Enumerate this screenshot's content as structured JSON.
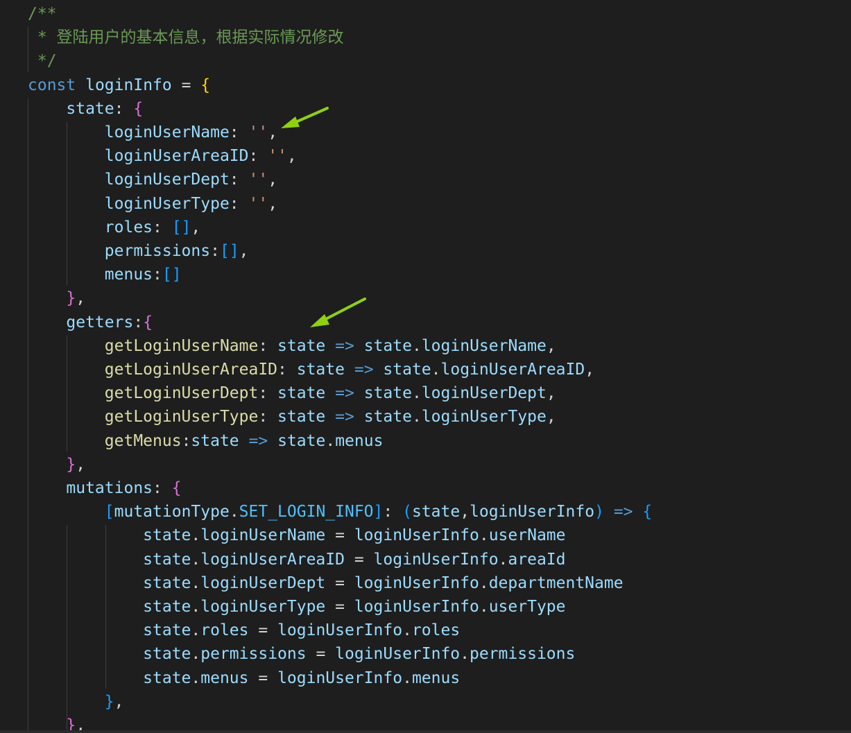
{
  "colors": {
    "background": "#1e1e1e",
    "comment": "#6a9955",
    "keyword": "#569cd6",
    "variable": "#9cdcfe",
    "function": "#dcdcaa",
    "constant": "#4fc1ff",
    "string": "#ce9178",
    "bracket_level_1": "#ffd700",
    "bracket_level_2": "#da70d6",
    "bracket_level_3": "#179fff",
    "annotation_arrow": "#8fd10f"
  },
  "annotations": [
    "arrow-pointer-icon",
    "arrow-pointer-icon"
  ],
  "lines": [
    [
      {
        "t": "/**",
        "c": "comment"
      }
    ],
    [
      {
        "t": " * 登陆用户的基本信息，根据实际情况修改",
        "c": "comment"
      }
    ],
    [
      {
        "t": " */",
        "c": "comment"
      }
    ],
    [
      {
        "t": "const",
        "c": "keyword"
      },
      {
        "t": " ",
        "c": "punc"
      },
      {
        "t": "loginInfo",
        "c": "var"
      },
      {
        "t": " = ",
        "c": "punc"
      },
      {
        "t": "{",
        "c": "b1"
      }
    ],
    [
      {
        "t": "    state",
        "c": "var"
      },
      {
        "t": ": ",
        "c": "punc"
      },
      {
        "t": "{",
        "c": "b2"
      }
    ],
    [
      {
        "t": "        loginUserName",
        "c": "var"
      },
      {
        "t": ": ",
        "c": "punc"
      },
      {
        "t": "''",
        "c": "str"
      },
      {
        "t": ",",
        "c": "punc"
      }
    ],
    [
      {
        "t": "        loginUserAreaID",
        "c": "var"
      },
      {
        "t": ": ",
        "c": "punc"
      },
      {
        "t": "''",
        "c": "str"
      },
      {
        "t": ",",
        "c": "punc"
      }
    ],
    [
      {
        "t": "        loginUserDept",
        "c": "var"
      },
      {
        "t": ": ",
        "c": "punc"
      },
      {
        "t": "''",
        "c": "str"
      },
      {
        "t": ",",
        "c": "punc"
      }
    ],
    [
      {
        "t": "        loginUserType",
        "c": "var"
      },
      {
        "t": ": ",
        "c": "punc"
      },
      {
        "t": "''",
        "c": "str"
      },
      {
        "t": ",",
        "c": "punc"
      }
    ],
    [
      {
        "t": "        roles",
        "c": "var"
      },
      {
        "t": ": ",
        "c": "punc"
      },
      {
        "t": "[]",
        "c": "b3"
      },
      {
        "t": ",",
        "c": "punc"
      }
    ],
    [
      {
        "t": "        permissions",
        "c": "var"
      },
      {
        "t": ":",
        "c": "punc"
      },
      {
        "t": "[]",
        "c": "b3"
      },
      {
        "t": ",",
        "c": "punc"
      }
    ],
    [
      {
        "t": "        menus",
        "c": "var"
      },
      {
        "t": ":",
        "c": "punc"
      },
      {
        "t": "[]",
        "c": "b3"
      }
    ],
    [
      {
        "t": "    ",
        "c": "punc"
      },
      {
        "t": "}",
        "c": "b2"
      },
      {
        "t": ",",
        "c": "punc"
      }
    ],
    [
      {
        "t": "    getters",
        "c": "var"
      },
      {
        "t": ":",
        "c": "punc"
      },
      {
        "t": "{",
        "c": "b2"
      }
    ],
    [
      {
        "t": "        getLoginUserName",
        "c": "fn"
      },
      {
        "t": ": ",
        "c": "punc"
      },
      {
        "t": "state",
        "c": "var"
      },
      {
        "t": " ",
        "c": "punc"
      },
      {
        "t": "=>",
        "c": "arrow"
      },
      {
        "t": " ",
        "c": "punc"
      },
      {
        "t": "state",
        "c": "var"
      },
      {
        "t": ".",
        "c": "punc"
      },
      {
        "t": "loginUserName",
        "c": "var"
      },
      {
        "t": ",",
        "c": "punc"
      }
    ],
    [
      {
        "t": "        getLoginUserAreaID",
        "c": "fn"
      },
      {
        "t": ": ",
        "c": "punc"
      },
      {
        "t": "state",
        "c": "var"
      },
      {
        "t": " ",
        "c": "punc"
      },
      {
        "t": "=>",
        "c": "arrow"
      },
      {
        "t": " ",
        "c": "punc"
      },
      {
        "t": "state",
        "c": "var"
      },
      {
        "t": ".",
        "c": "punc"
      },
      {
        "t": "loginUserAreaID",
        "c": "var"
      },
      {
        "t": ",",
        "c": "punc"
      }
    ],
    [
      {
        "t": "        getLoginUserDept",
        "c": "fn"
      },
      {
        "t": ": ",
        "c": "punc"
      },
      {
        "t": "state",
        "c": "var"
      },
      {
        "t": " ",
        "c": "punc"
      },
      {
        "t": "=>",
        "c": "arrow"
      },
      {
        "t": " ",
        "c": "punc"
      },
      {
        "t": "state",
        "c": "var"
      },
      {
        "t": ".",
        "c": "punc"
      },
      {
        "t": "loginUserDept",
        "c": "var"
      },
      {
        "t": ",",
        "c": "punc"
      }
    ],
    [
      {
        "t": "        getLoginUserType",
        "c": "fn"
      },
      {
        "t": ": ",
        "c": "punc"
      },
      {
        "t": "state",
        "c": "var"
      },
      {
        "t": " ",
        "c": "punc"
      },
      {
        "t": "=>",
        "c": "arrow"
      },
      {
        "t": " ",
        "c": "punc"
      },
      {
        "t": "state",
        "c": "var"
      },
      {
        "t": ".",
        "c": "punc"
      },
      {
        "t": "loginUserType",
        "c": "var"
      },
      {
        "t": ",",
        "c": "punc"
      }
    ],
    [
      {
        "t": "        getMenus",
        "c": "fn"
      },
      {
        "t": ":",
        "c": "punc"
      },
      {
        "t": "state",
        "c": "var"
      },
      {
        "t": " ",
        "c": "punc"
      },
      {
        "t": "=>",
        "c": "arrow"
      },
      {
        "t": " ",
        "c": "punc"
      },
      {
        "t": "state",
        "c": "var"
      },
      {
        "t": ".",
        "c": "punc"
      },
      {
        "t": "menus",
        "c": "var"
      }
    ],
    [
      {
        "t": "    ",
        "c": "punc"
      },
      {
        "t": "}",
        "c": "b2"
      },
      {
        "t": ",",
        "c": "punc"
      }
    ],
    [
      {
        "t": "    mutations",
        "c": "var"
      },
      {
        "t": ": ",
        "c": "punc"
      },
      {
        "t": "{",
        "c": "b2"
      }
    ],
    [
      {
        "t": "        ",
        "c": "punc"
      },
      {
        "t": "[",
        "c": "b3"
      },
      {
        "t": "mutationType",
        "c": "var"
      },
      {
        "t": ".",
        "c": "punc"
      },
      {
        "t": "SET_LOGIN_INFO",
        "c": "const"
      },
      {
        "t": "]",
        "c": "b3"
      },
      {
        "t": ": ",
        "c": "punc"
      },
      {
        "t": "(",
        "c": "b3"
      },
      {
        "t": "state",
        "c": "var"
      },
      {
        "t": ",",
        "c": "punc"
      },
      {
        "t": "loginUserInfo",
        "c": "var"
      },
      {
        "t": ")",
        "c": "b3"
      },
      {
        "t": " ",
        "c": "punc"
      },
      {
        "t": "=>",
        "c": "arrow"
      },
      {
        "t": " ",
        "c": "punc"
      },
      {
        "t": "{",
        "c": "b3"
      }
    ],
    [
      {
        "t": "            state",
        "c": "var"
      },
      {
        "t": ".",
        "c": "punc"
      },
      {
        "t": "loginUserName",
        "c": "var"
      },
      {
        "t": " = ",
        "c": "punc"
      },
      {
        "t": "loginUserInfo",
        "c": "var"
      },
      {
        "t": ".",
        "c": "punc"
      },
      {
        "t": "userName",
        "c": "var"
      }
    ],
    [
      {
        "t": "            state",
        "c": "var"
      },
      {
        "t": ".",
        "c": "punc"
      },
      {
        "t": "loginUserAreaID",
        "c": "var"
      },
      {
        "t": " = ",
        "c": "punc"
      },
      {
        "t": "loginUserInfo",
        "c": "var"
      },
      {
        "t": ".",
        "c": "punc"
      },
      {
        "t": "areaId",
        "c": "var"
      }
    ],
    [
      {
        "t": "            state",
        "c": "var"
      },
      {
        "t": ".",
        "c": "punc"
      },
      {
        "t": "loginUserDept",
        "c": "var"
      },
      {
        "t": " = ",
        "c": "punc"
      },
      {
        "t": "loginUserInfo",
        "c": "var"
      },
      {
        "t": ".",
        "c": "punc"
      },
      {
        "t": "departmentName",
        "c": "var"
      }
    ],
    [
      {
        "t": "            state",
        "c": "var"
      },
      {
        "t": ".",
        "c": "punc"
      },
      {
        "t": "loginUserType",
        "c": "var"
      },
      {
        "t": " = ",
        "c": "punc"
      },
      {
        "t": "loginUserInfo",
        "c": "var"
      },
      {
        "t": ".",
        "c": "punc"
      },
      {
        "t": "userType",
        "c": "var"
      }
    ],
    [
      {
        "t": "            state",
        "c": "var"
      },
      {
        "t": ".",
        "c": "punc"
      },
      {
        "t": "roles",
        "c": "var"
      },
      {
        "t": " = ",
        "c": "punc"
      },
      {
        "t": "loginUserInfo",
        "c": "var"
      },
      {
        "t": ".",
        "c": "punc"
      },
      {
        "t": "roles",
        "c": "var"
      }
    ],
    [
      {
        "t": "            state",
        "c": "var"
      },
      {
        "t": ".",
        "c": "punc"
      },
      {
        "t": "permissions",
        "c": "var"
      },
      {
        "t": " = ",
        "c": "punc"
      },
      {
        "t": "loginUserInfo",
        "c": "var"
      },
      {
        "t": ".",
        "c": "punc"
      },
      {
        "t": "permissions",
        "c": "var"
      }
    ],
    [
      {
        "t": "            state",
        "c": "var"
      },
      {
        "t": ".",
        "c": "punc"
      },
      {
        "t": "menus",
        "c": "var"
      },
      {
        "t": " = ",
        "c": "punc"
      },
      {
        "t": "loginUserInfo",
        "c": "var"
      },
      {
        "t": ".",
        "c": "punc"
      },
      {
        "t": "menus",
        "c": "var"
      }
    ],
    [
      {
        "t": "        ",
        "c": "punc"
      },
      {
        "t": "}",
        "c": "b3"
      },
      {
        "t": ",",
        "c": "punc"
      }
    ],
    [
      {
        "t": "    ",
        "c": "punc"
      },
      {
        "t": "}",
        "c": "b2"
      },
      {
        "t": ",",
        "c": "punc"
      }
    ]
  ]
}
